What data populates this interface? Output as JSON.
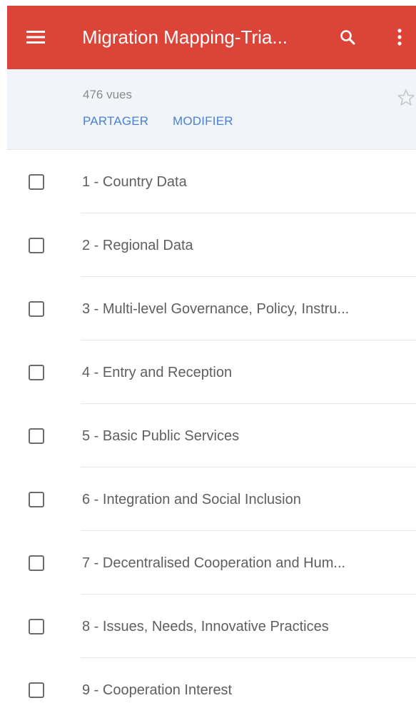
{
  "app_bar": {
    "title": "Migration Mapping-Tria...",
    "background_color": "#db4437",
    "menu_icon": "hamburger-menu-icon",
    "search_icon": "search-icon",
    "more_icon": "more-vert-icon"
  },
  "info": {
    "views": "476 vues",
    "share_label": "PARTAGER",
    "edit_label": "MODIFIER",
    "star_icon": "star-outline-icon",
    "link_color": "#4a80d8"
  },
  "items": [
    {
      "label": "1 - Country Data",
      "checked": false
    },
    {
      "label": "2 - Regional Data",
      "checked": false
    },
    {
      "label": "3 - Multi-level Governance, Policy, Instru...",
      "checked": false
    },
    {
      "label": "4 - Entry and Reception",
      "checked": false
    },
    {
      "label": "5 - Basic Public Services",
      "checked": false
    },
    {
      "label": "6 - Integration and Social Inclusion",
      "checked": false
    },
    {
      "label": "7 - Decentralised Cooperation and Hum...",
      "checked": false
    },
    {
      "label": "8 - Issues, Needs, Innovative Practices",
      "checked": false
    },
    {
      "label": "9 - Cooperation Interest",
      "checked": false
    }
  ]
}
